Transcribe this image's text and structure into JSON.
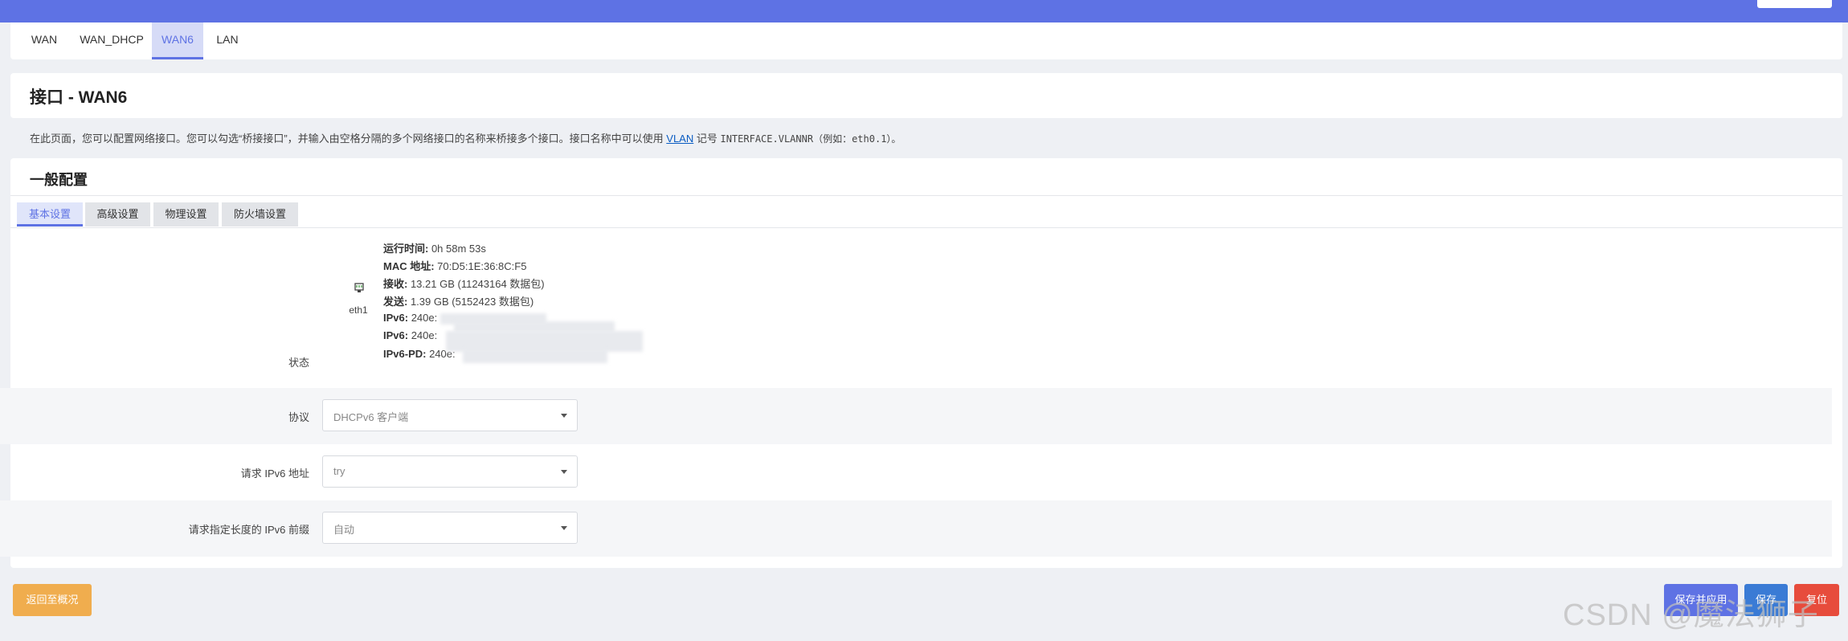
{
  "tabs": [
    "WAN",
    "WAN_DHCP",
    "WAN6",
    "LAN"
  ],
  "page_title": "接口 - WAN6",
  "description": {
    "prefix": "在此页面，您可以配置网络接口。您可以勾选“桥接接口”，并输入由空格分隔的多个网络接口的名称来桥接多个接口。接口名称中可以使用 ",
    "link": "VLAN",
    "mid": " 记号 ",
    "code": "INTERFACE.VLANNR",
    "suffix": "（例如：eth0.1）。"
  },
  "section_title": "一般配置",
  "subtabs": [
    "基本设置",
    "高级设置",
    "物理设置",
    "防火墙设置"
  ],
  "status": {
    "label": "状态",
    "interface": "eth1",
    "uptime_label": "运行时间:",
    "uptime": " 0h 58m 53s",
    "mac_label": "MAC 地址:",
    "mac": " 70:D5:1E:36:8C:F5",
    "rx_label": "接收:",
    "rx": " 13.21 GB (11243164 数据包)",
    "tx_label": "发送:",
    "tx": " 1.39 GB (5152423 数据包)",
    "ipv6_label": "IPv6:",
    "ipv6_1": " 240e:",
    "ipv6_2": " 240e:",
    "ipv6pd_label": "IPv6-PD:",
    "ipv6pd": " 240e:"
  },
  "fields": {
    "protocol_label": "协议",
    "protocol_value": "DHCPv6 客户端",
    "reqaddr_label": "请求 IPv6 地址",
    "reqaddr_value": "try",
    "prefix_label": "请求指定长度的 IPv6 前缀",
    "prefix_value": "自动"
  },
  "buttons": {
    "back": "返回至概况",
    "save_apply": "保存并应用",
    "save": "保存",
    "reset": "复位"
  },
  "watermark": "CSDN @魔法狮子"
}
